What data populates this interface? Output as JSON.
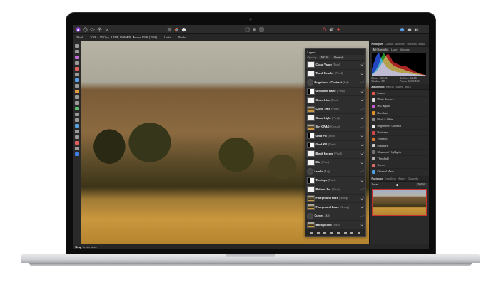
{
  "app": {
    "context": [
      "Pixel",
      "2048 × 1512px, 3.1MP, RGBA/8 - Adobe RGB (1998)",
      "Units",
      "Pixels"
    ],
    "status": {
      "bold": "Drag",
      "text": "to pan view."
    }
  },
  "layers": {
    "title": "Layers",
    "opacity_label": "Opacity",
    "opacity": "100 %",
    "blend": "Normal",
    "items": [
      {
        "name": "Cloud Vapor",
        "type": "(Pixel)",
        "kind": "pixel",
        "visible": true
      },
      {
        "name": "Trunk Detailer",
        "type": "(Pixel)",
        "kind": "pixel",
        "visible": true
      },
      {
        "name": "Brightness / Contrast",
        "type": "(Adj)",
        "kind": "adjustment",
        "visible": true
      },
      {
        "name": "Unlocked Matte",
        "type": "(Pixel)",
        "kind": "mask",
        "visible": true
      },
      {
        "name": "Omen Line",
        "type": "(Pixel)",
        "kind": "pixel",
        "visible": true
      },
      {
        "name": "Clone THIS",
        "type": "(Pixel)",
        "kind": "group",
        "visible": true
      },
      {
        "name": "Cloud Light",
        "type": "(Pixel)",
        "kind": "pixel",
        "visible": true
      },
      {
        "name": "Sky GRAD",
        "type": "(Group)",
        "kind": "group",
        "visible": true
      },
      {
        "name": "Grad Fix",
        "type": "(Pixel)",
        "kind": "mask",
        "visible": true
      },
      {
        "name": "Grad Kill",
        "type": "(Pixel)",
        "kind": "mask",
        "visible": true
      },
      {
        "name": "Black Keeper",
        "type": "(Pixel)",
        "kind": "pixel",
        "visible": true
      },
      {
        "name": "Mix",
        "type": "(Pixel)",
        "kind": "pixel",
        "visible": true
      },
      {
        "name": "Levels",
        "type": "(Adj)",
        "kind": "adjustment",
        "visible": true
      },
      {
        "name": "Treetops",
        "type": "(Pixel)",
        "kind": "mask",
        "visible": true
      },
      {
        "name": "Refined Sat",
        "type": "(Pixel)",
        "kind": "pixel",
        "visible": true
      },
      {
        "name": "Foreground Mids",
        "type": "(Group)",
        "kind": "group",
        "visible": true
      },
      {
        "name": "Foreground Lows",
        "type": "(Group)",
        "kind": "group",
        "visible": true
      },
      {
        "name": "Curves",
        "type": "(Adj)",
        "kind": "adjustment",
        "visible": true
      },
      {
        "name": "Background",
        "type": "(Pixel)",
        "kind": "group",
        "visible": true
      }
    ]
  },
  "histogram": {
    "tabs": [
      {
        "label": "Histogram",
        "selected": true
      },
      {
        "label": "Colour",
        "selected": false
      },
      {
        "label": "Swatches",
        "selected": false
      },
      {
        "label": "Brushes",
        "selected": false
      },
      {
        "label": "Stock",
        "selected": false
      }
    ],
    "channel": "All Channels",
    "options": [
      "Layer",
      "Marquee"
    ],
    "stats": [
      "Mean: 128.24",
      "Std Dev: 62.18",
      "Median: 129",
      "Pixels: 3,097,152"
    ],
    "red": [
      0.05,
      0.1,
      0.2,
      0.35,
      0.5,
      0.7,
      0.9,
      0.95,
      0.8,
      0.6,
      0.55,
      0.5,
      0.45,
      0.4,
      0.42,
      0.38,
      0.3,
      0.25,
      0.2,
      0.15,
      0.1,
      0.08,
      0.05,
      0.02
    ],
    "green": [
      0.08,
      0.15,
      0.3,
      0.5,
      0.8,
      1.0,
      0.85,
      0.7,
      0.55,
      0.45,
      0.4,
      0.35,
      0.3,
      0.28,
      0.25,
      0.2,
      0.18,
      0.15,
      0.12,
      0.1,
      0.08,
      0.05,
      0.03,
      0.01
    ],
    "blue": [
      0.3,
      0.6,
      0.9,
      1.0,
      0.75,
      0.55,
      0.4,
      0.3,
      0.25,
      0.2,
      0.18,
      0.15,
      0.13,
      0.12,
      0.1,
      0.1,
      0.08,
      0.07,
      0.06,
      0.05,
      0.04,
      0.03,
      0.02,
      0.01
    ]
  },
  "adjustments": {
    "tabs": [
      {
        "label": "Adjustment",
        "selected": true
      },
      {
        "label": "Effects",
        "selected": false
      },
      {
        "label": "Styles",
        "selected": false
      },
      {
        "label": "Stock",
        "selected": false
      }
    ],
    "items": [
      {
        "label": "Levels",
        "color": "#e05a4a"
      },
      {
        "label": "White Balance",
        "color": "#dddddd"
      },
      {
        "label": "HSL Adjust",
        "color": "#c45ad0"
      },
      {
        "label": "Recolour",
        "color": "#e0902e"
      },
      {
        "label": "Black & White",
        "color": "#8a8a8a"
      },
      {
        "label": "Brightness / Contrast",
        "color": "#e8e8e8"
      },
      {
        "label": "Posterise",
        "color": "#d04848"
      },
      {
        "label": "Vibrance",
        "color": "#d8762c"
      },
      {
        "label": "Exposure",
        "color": "#c8c8c8"
      },
      {
        "label": "Shadows / Highlights",
        "color": "#707070"
      },
      {
        "label": "Threshold",
        "color": "#b0b0b0"
      },
      {
        "label": "Curves",
        "color": "#e06868"
      },
      {
        "label": "Channel Mixer",
        "color": "#4fa0e0"
      }
    ]
  },
  "navigator": {
    "tabs": [
      {
        "label": "Navigator",
        "selected": true
      },
      {
        "label": "Transform",
        "selected": false
      },
      {
        "label": "History",
        "selected": false
      },
      {
        "label": "Channels",
        "selected": false
      }
    ],
    "zoom_label": "Zoom",
    "zoom": "100 %"
  }
}
